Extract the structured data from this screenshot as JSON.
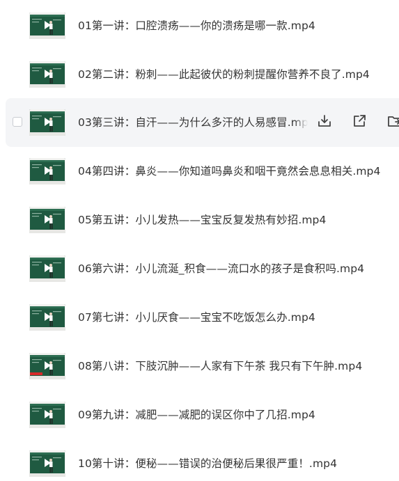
{
  "files": [
    {
      "name": "01第一讲：口腔溃疡——你的溃疡是哪一款.mp4",
      "thumb_variant": "standing"
    },
    {
      "name": "02第二讲：粉刺——此起彼伏的粉刺提醒你营养不良了.mp4",
      "thumb_variant": "standing"
    },
    {
      "name": "03第三讲：自汗——为什么多汗的人易感冒.mp4",
      "thumb_variant": "standing",
      "hovered": true
    },
    {
      "name": "04第四讲：鼻炎——你知道吗鼻炎和咽干竟然会息息相关.mp4",
      "thumb_variant": "standing"
    },
    {
      "name": "05第五讲：小儿发热——宝宝反复发热有妙招.mp4",
      "thumb_variant": "standing"
    },
    {
      "name": "06第六讲：小儿流涎_积食——流口水的孩子是食积吗.mp4",
      "thumb_variant": "standing"
    },
    {
      "name": "07第七讲：小儿厌食——宝宝不吃饭怎么办.mp4",
      "thumb_variant": "standing"
    },
    {
      "name": "08第八讲：下肢沉肿——人家有下午茶 我只有下午肿.mp4",
      "thumb_variant": "red-banner"
    },
    {
      "name": "09第九讲：减肥——减肥的误区你中了几招.mp4",
      "thumb_variant": "standing"
    },
    {
      "name": "10第十讲：便秘——错误的治便秘后果很严重！.mp4",
      "thumb_variant": "standing"
    }
  ],
  "hover_actions": [
    {
      "icon": "download-icon"
    },
    {
      "icon": "share-icon"
    },
    {
      "icon": "folder-icon"
    }
  ],
  "colors": {
    "text": "#333333",
    "hover_bg": "#f4f5f7",
    "thumb_board": "#1e4e3a",
    "icon": "#444444"
  }
}
